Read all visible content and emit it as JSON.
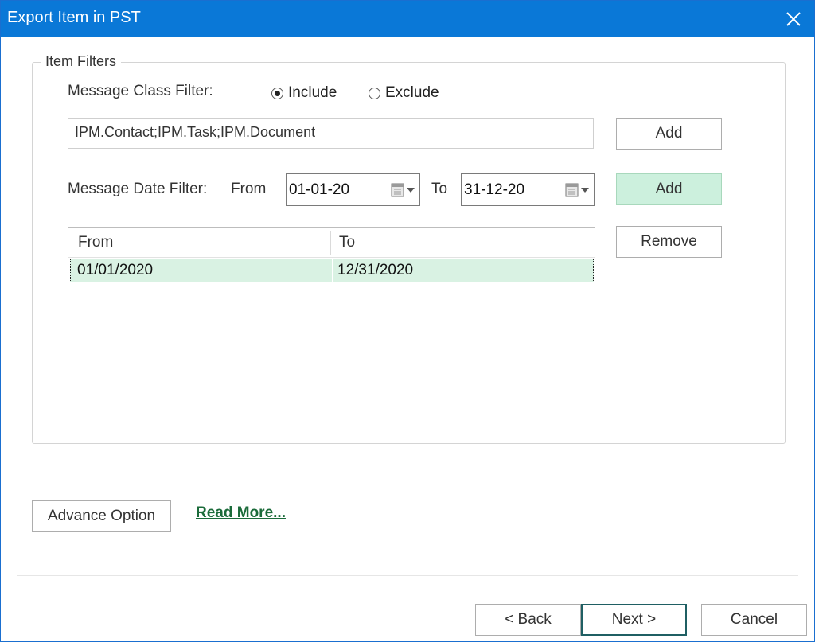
{
  "window": {
    "title": "Export Item in PST"
  },
  "filters": {
    "group_label": "Item Filters",
    "message_class": {
      "label": "Message Class Filter:",
      "include_label": "Include",
      "exclude_label": "Exclude",
      "selected": "Include",
      "value": "IPM.Contact;IPM.Task;IPM.Document",
      "add_label": "Add"
    },
    "message_date": {
      "label": "Message Date Filter:",
      "from_label": "From",
      "from_value": "01-01-20",
      "to_label": "To",
      "to_value": "31-12-20",
      "add_label": "Add",
      "remove_label": "Remove"
    },
    "table": {
      "columns": [
        "From",
        "To"
      ],
      "rows": [
        [
          "01/01/2020",
          "12/31/2020"
        ]
      ]
    }
  },
  "footer": {
    "advance_label": "Advance Option",
    "read_more_label": "Read More...",
    "back_label": "< Back",
    "next_label": "Next >",
    "cancel_label": "Cancel"
  },
  "colors": {
    "titlebar": "#0a78d7",
    "accent_green": "#ccf0dd",
    "selection": "#d9f2e3",
    "link": "#1b6b3a"
  },
  "icons": [
    "close-icon",
    "calendar-icon",
    "dropdown-arrow-icon"
  ]
}
